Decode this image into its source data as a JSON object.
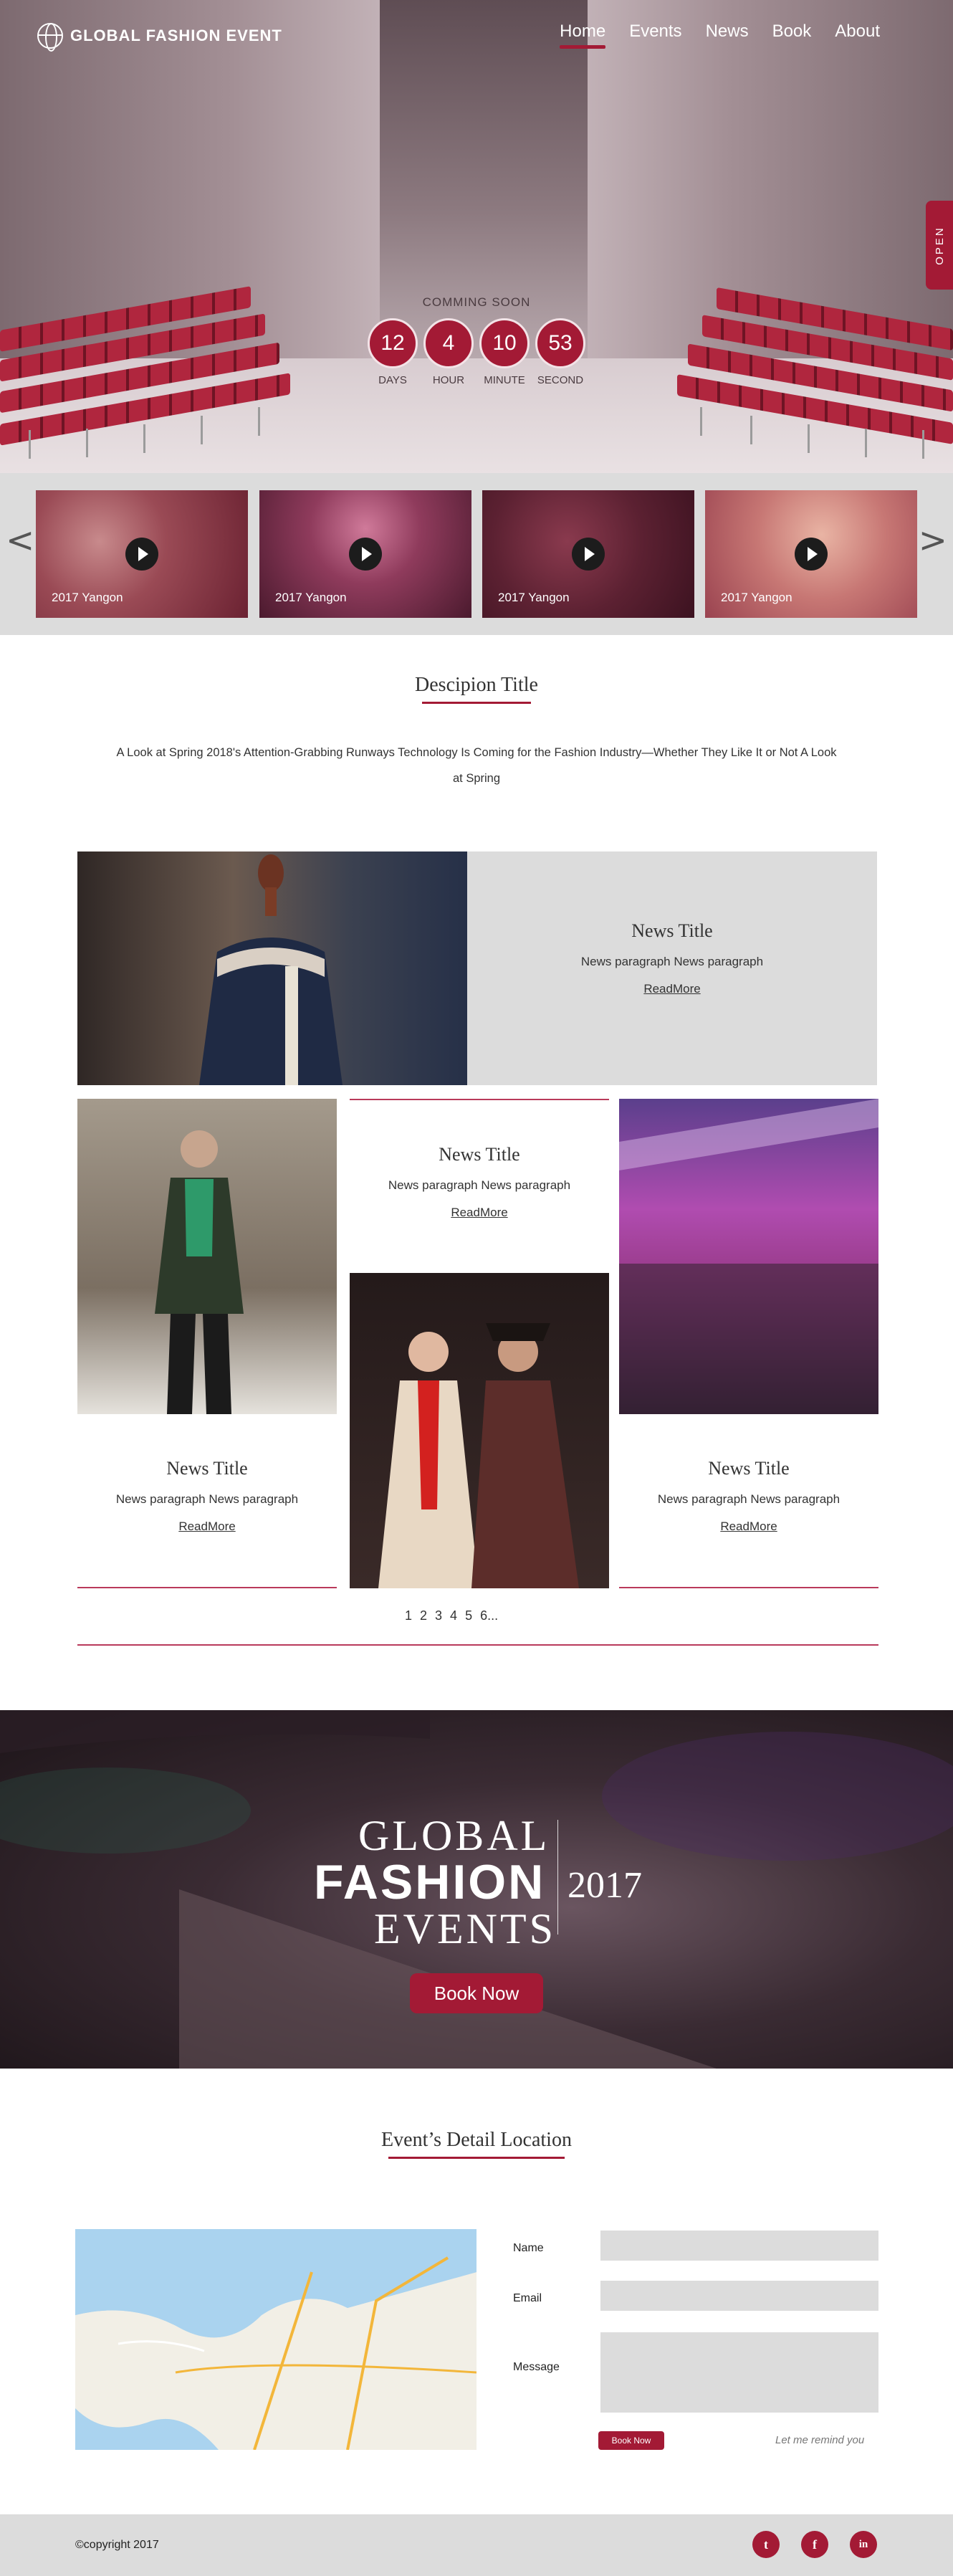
{
  "header": {
    "brand": "GLOBAL FASHION EVENT",
    "nav": [
      {
        "label": "Home",
        "active": true
      },
      {
        "label": "Events",
        "active": false
      },
      {
        "label": "News",
        "active": false
      },
      {
        "label": "Book",
        "active": false
      },
      {
        "label": "About",
        "active": false
      }
    ],
    "open_tab": "OPEN"
  },
  "countdown": {
    "heading": "COMMING SOON",
    "units": [
      {
        "value": "12",
        "label": "DAYS"
      },
      {
        "value": "4",
        "label": "HOUR"
      },
      {
        "value": "10",
        "label": "MINUTE"
      },
      {
        "value": "53",
        "label": "SECOND"
      }
    ]
  },
  "videos": {
    "prev_arrow": "<",
    "next_arrow": ">",
    "items": [
      {
        "caption": "2017 Yangon"
      },
      {
        "caption": "2017 Yangon"
      },
      {
        "caption": "2017 Yangon"
      },
      {
        "caption": "2017 Yangon"
      }
    ]
  },
  "description": {
    "title": "Descipion Title",
    "text": "A Look at Spring 2018's Attention-Grabbing Runways Technology Is Coming for the Fashion Industry—Whether They Like It or Not A Look at Spring"
  },
  "news": {
    "items": [
      {
        "title": "News Title",
        "paragraph": "News paragraph News paragraph",
        "link": "ReadMore"
      },
      {
        "title": "News Title",
        "paragraph": "News paragraph News paragraph",
        "link": "ReadMore"
      },
      {
        "title": "News Title",
        "paragraph": "News paragraph News paragraph",
        "link": "ReadMore"
      },
      {
        "title": "News Title",
        "paragraph": "News paragraph News paragraph",
        "link": "ReadMore"
      }
    ],
    "pagination": [
      "1",
      "2",
      "3",
      "4",
      "5",
      "6..."
    ]
  },
  "banner": {
    "line1": "GLOBAL",
    "line2": "FASHION",
    "line3": "EVENTS",
    "year": "2017",
    "button": "Book Now"
  },
  "location": {
    "title": "Event’s  Detail  Location",
    "form": {
      "name_label": "Name",
      "email_label": "Email",
      "message_label": "Message",
      "submit": "Book Now",
      "remind": "Let me remind you"
    }
  },
  "footer": {
    "copyright": "©copyright 2017",
    "social": [
      {
        "icon": "tumblr-icon",
        "glyph": "t"
      },
      {
        "icon": "facebook-icon",
        "glyph": "f"
      },
      {
        "icon": "linkedin-icon",
        "glyph": "in"
      }
    ]
  },
  "colors": {
    "accent": "#a31a35",
    "light_gray": "#dcdcdc"
  }
}
